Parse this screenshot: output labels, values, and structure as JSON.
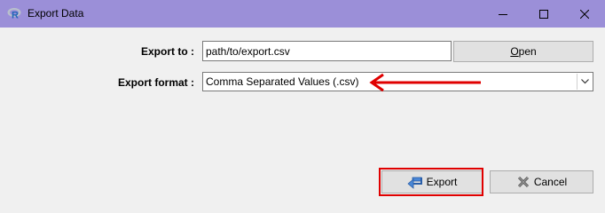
{
  "window": {
    "title": "Export Data",
    "icon": "r-logo-icon"
  },
  "form": {
    "export_to_label": "Export to :",
    "export_path_value": "path/to/export.csv",
    "open_button_label_underlined": "O",
    "open_button_label_rest": "pen",
    "export_format_label": "Export format :",
    "export_format_selected": "Comma Separated Values (.csv)"
  },
  "buttons": {
    "export_label": "Export",
    "cancel_label": "Cancel"
  },
  "annotations": {
    "color": "#e00000"
  }
}
